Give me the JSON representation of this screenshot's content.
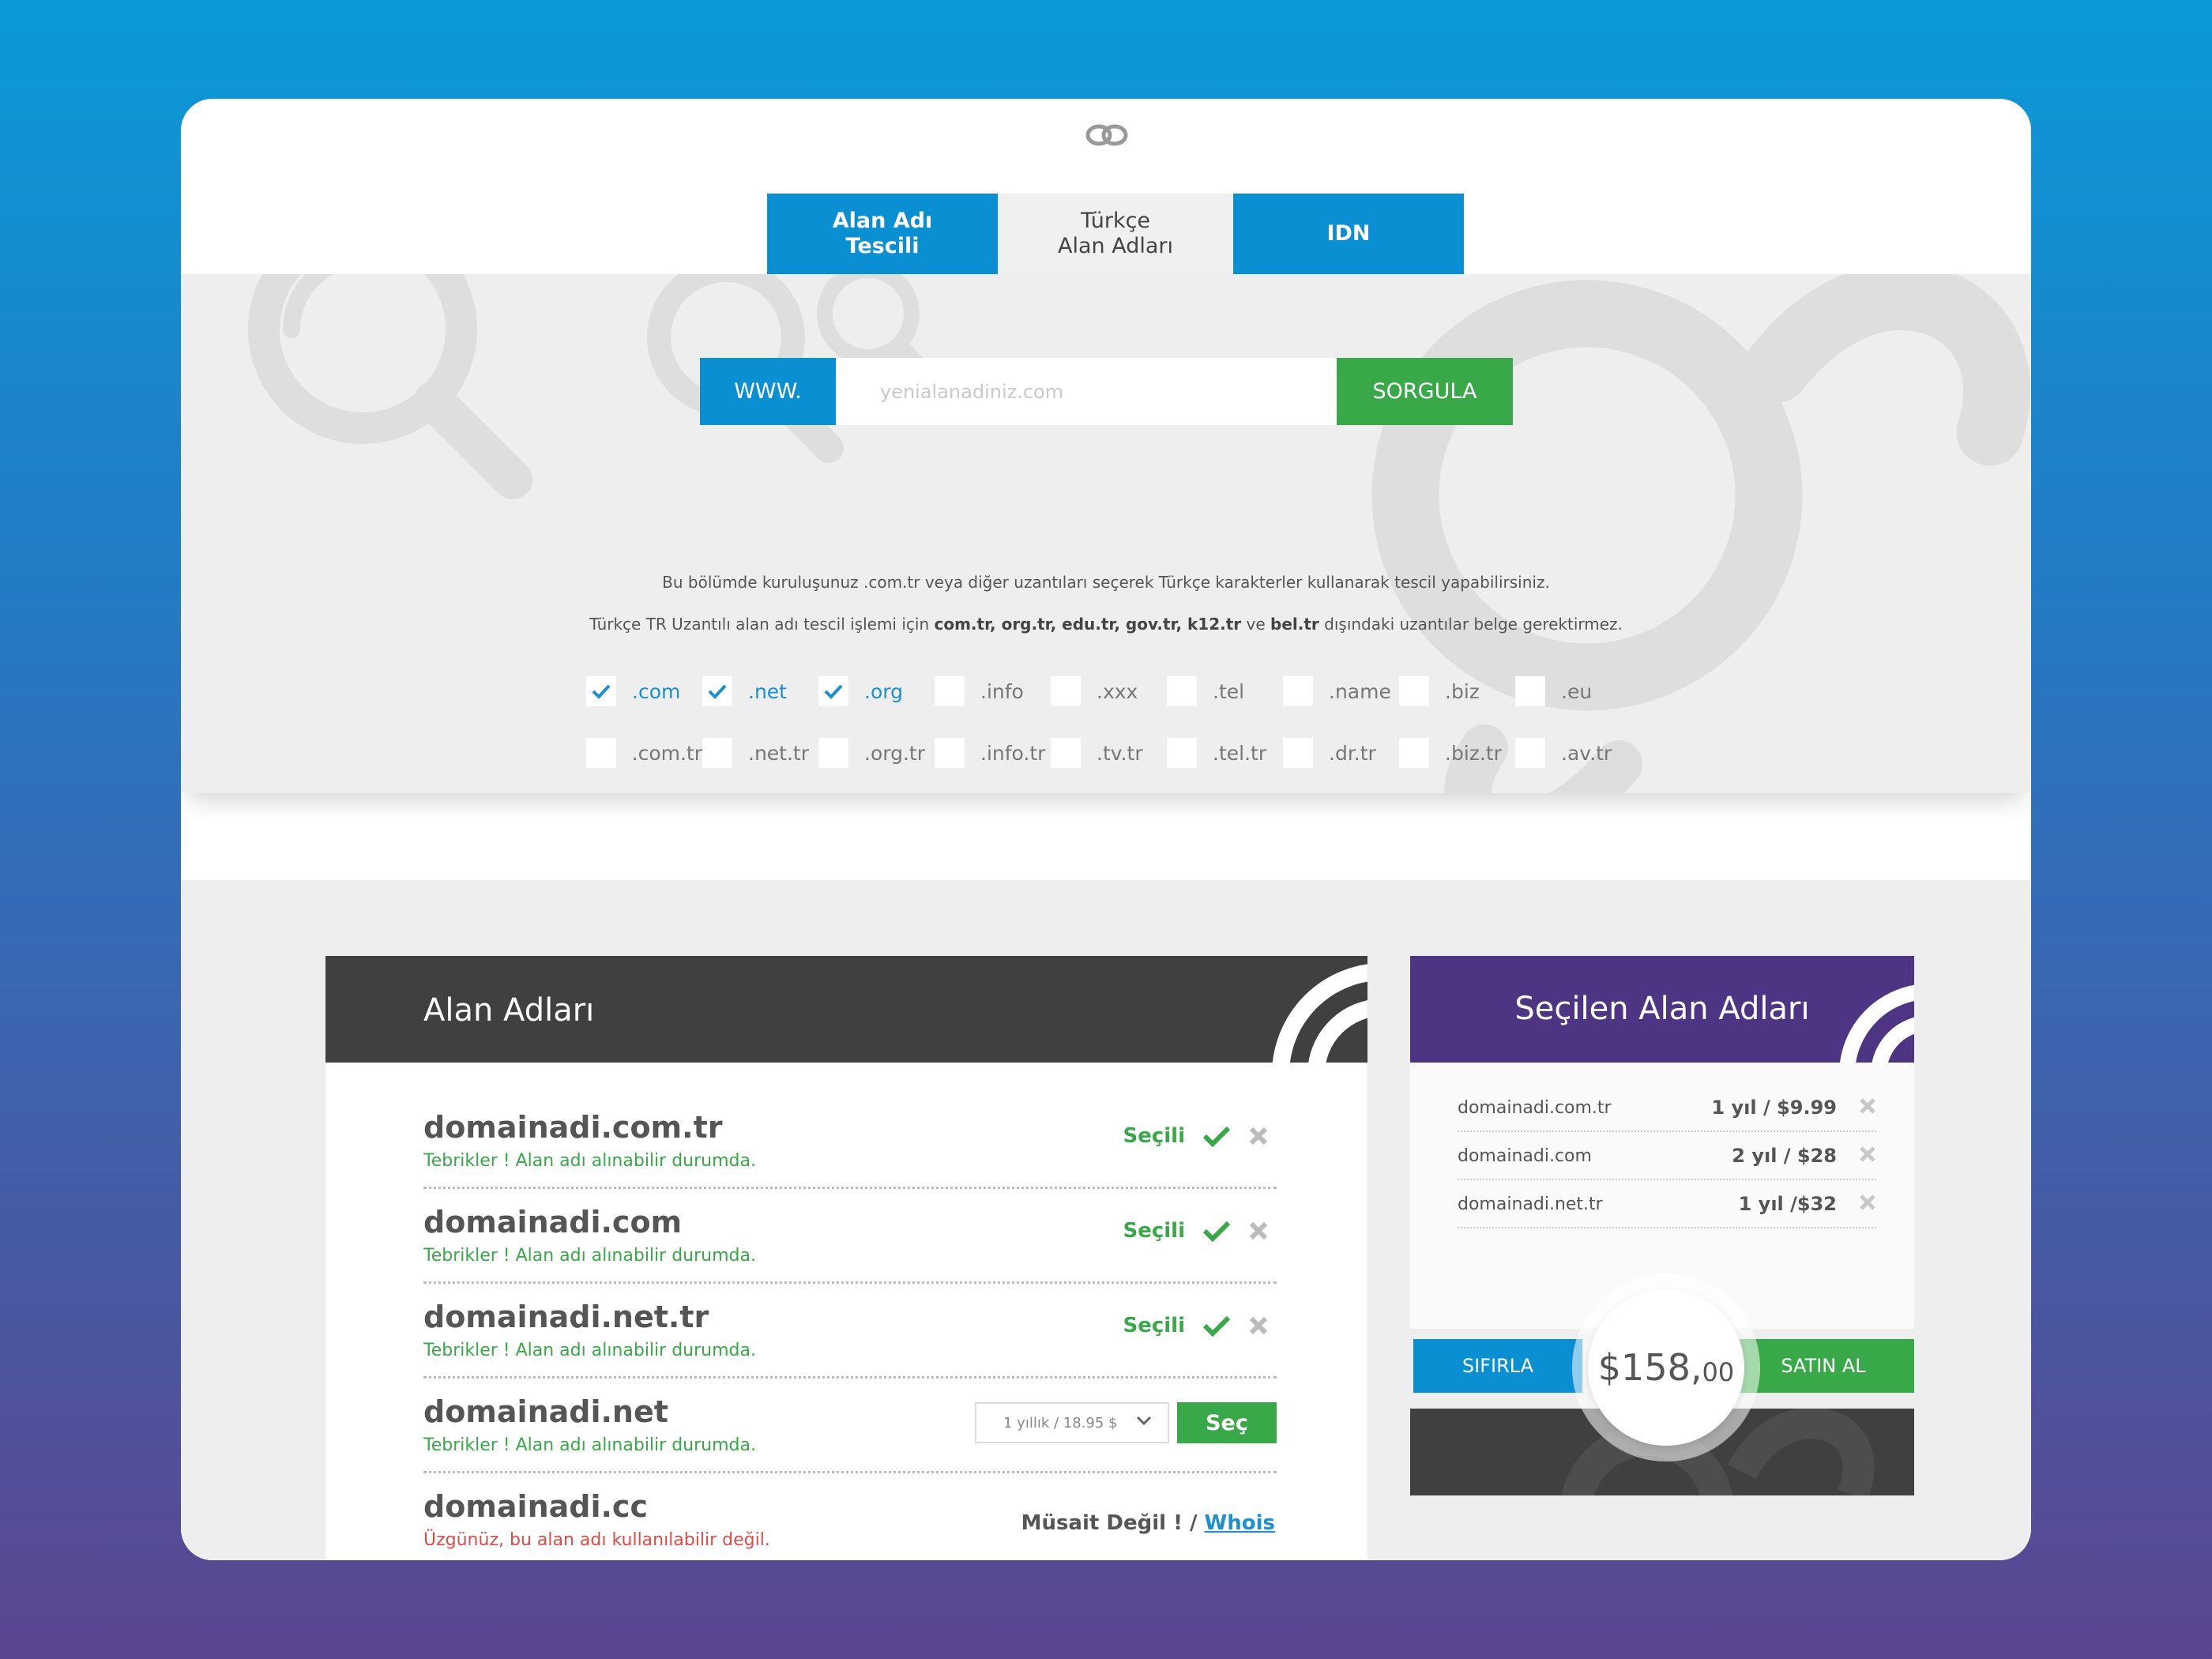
{
  "tabs": [
    {
      "label": "Alan Adı\nTescili"
    },
    {
      "label": "Türkçe\nAlan Adları"
    },
    {
      "label": "IDN"
    }
  ],
  "search": {
    "prefix": "WWW.",
    "placeholder": "yenialanadiniz.com",
    "button": "SORGULA"
  },
  "info": {
    "line1": "Bu bölümde kuruluşunuz .com.tr veya diğer uzantıları seçerek Türkçe karakterler kullanarak tescil yapabilirsiniz.",
    "line2_pre": "Türkçe TR Uzantılı alan adı tescil işlemi için ",
    "line2_bold": "com.tr, org.tr, edu.tr, gov.tr, k12.tr",
    "line2_mid": " ve ",
    "line2_bold2": "bel.tr",
    "line2_post": " dışındaki uzantılar belge gerektirmez."
  },
  "extensions_row1": [
    {
      "label": ".com",
      "checked": true
    },
    {
      "label": ".net",
      "checked": true
    },
    {
      "label": ".org",
      "checked": true
    },
    {
      "label": ".info",
      "checked": false
    },
    {
      "label": ".xxx",
      "checked": false
    },
    {
      "label": ".tel",
      "checked": false
    },
    {
      "label": ".name",
      "checked": false
    },
    {
      "label": ".biz",
      "checked": false
    },
    {
      "label": ".eu",
      "checked": false
    }
  ],
  "extensions_row2": [
    {
      "label": ".com.tr",
      "checked": false
    },
    {
      "label": ".net.tr",
      "checked": false
    },
    {
      "label": ".org.tr",
      "checked": false
    },
    {
      "label": ".info.tr",
      "checked": false
    },
    {
      "label": ".tv.tr",
      "checked": false
    },
    {
      "label": ".tel.tr",
      "checked": false
    },
    {
      "label": ".dr.tr",
      "checked": false
    },
    {
      "label": ".biz.tr",
      "checked": false
    },
    {
      "label": ".av.tr",
      "checked": false
    }
  ],
  "results": {
    "title": "Alan Adları",
    "rows": [
      {
        "domain": "domainadi.com.tr",
        "status": "Tebrikler ! Alan adı alınabilir durumda.",
        "state": "selected",
        "selected_label": "Seçili"
      },
      {
        "domain": "domainadi.com",
        "status": "Tebrikler ! Alan adı alınabilir durumda.",
        "state": "selected",
        "selected_label": "Seçili"
      },
      {
        "domain": "domainadi.net.tr",
        "status": "Tebrikler ! Alan adı alınabilir durumda.",
        "state": "selected",
        "selected_label": "Seçili"
      },
      {
        "domain": "domainadi.net",
        "status": "Tebrikler ! Alan adı alınabilir durumda.",
        "state": "available",
        "period": "1 yıllık / 18.95 $",
        "select_label": "Seç"
      },
      {
        "domain": "domainadi.cc",
        "status": "Üzgünüz, bu alan adı kullanılabilir değil.",
        "state": "unavailable",
        "unavail_label": "Müsait Değil ! /",
        "whois_label": "Whois"
      }
    ]
  },
  "selected": {
    "title": "Seçilen Alan Adları",
    "items": [
      {
        "domain": "domainadi.com.tr",
        "price": "1 yıl / $9.99"
      },
      {
        "domain": "domainadi.com",
        "price": "2 yıl / $28"
      },
      {
        "domain": "domainadi.net.tr",
        "price": "1 yıl /$32"
      }
    ],
    "reset": "SIFIRLA",
    "buy": "SATIN AL",
    "total_main": "$158,",
    "total_cents": "00"
  },
  "colors": {
    "blue": "#0a8fd3",
    "green": "#38a848",
    "purple": "#4e3583",
    "dark": "#404040",
    "red": "#e24a45"
  }
}
